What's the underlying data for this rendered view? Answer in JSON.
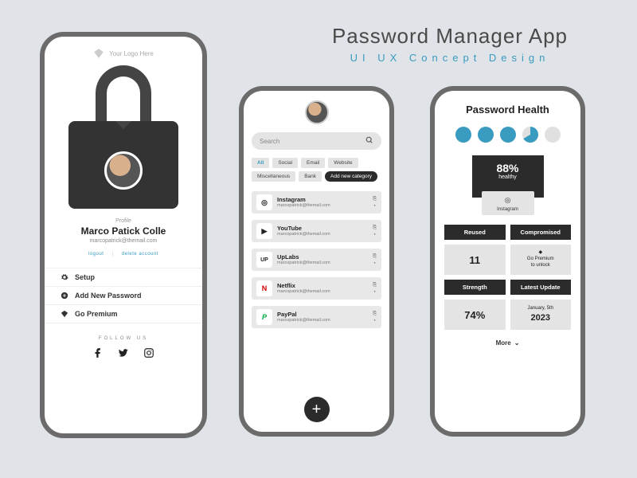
{
  "header": {
    "title": "Password Manager App",
    "subtitle": "UI UX Concept Design"
  },
  "phone1": {
    "logo_placeholder": "Your Logo Here",
    "profile_caption": "Profile",
    "name": "Marco Patick Colle",
    "email": "marcopatrick@themail.com",
    "logout": "logout",
    "delete": "delete account",
    "menu": {
      "setup": "Setup",
      "add": "Add New Password",
      "premium": "Go Premium"
    },
    "follow_label": "FOLLOW US"
  },
  "phone2": {
    "search_placeholder": "Search",
    "chips": [
      "All",
      "Social",
      "Email",
      "Website",
      "Miscellaneous",
      "Bank"
    ],
    "add_category": "Add new category",
    "entries": [
      {
        "name": "Instagram",
        "email": "marcopatrick@themail.com",
        "glyph": "◎"
      },
      {
        "name": "YouTube",
        "email": "marcopatrick@themail.com",
        "glyph": "▶"
      },
      {
        "name": "UpLabs",
        "email": "marcopatrick@themail.com",
        "glyph": "UP"
      },
      {
        "name": "Netflix",
        "email": "marcopatrick@themail.com",
        "glyph": "N"
      },
      {
        "name": "PayPal",
        "email": "marcopatrick@themail.com",
        "glyph": "P"
      }
    ]
  },
  "phone3": {
    "title": "Password Health",
    "score_pct": "88%",
    "score_label": "healthy",
    "score_app": "Instagram",
    "stats": {
      "reused_label": "Reused",
      "reused_value": "11",
      "compromised_label": "Compromised",
      "compromised_hint_top": "Go Premium",
      "compromised_hint_bot": "to unlock",
      "strength_label": "Strength",
      "strength_value": "74%",
      "update_label": "Latest Update",
      "update_line1": "January, 5th",
      "update_line2": "2023"
    },
    "more": "More"
  }
}
